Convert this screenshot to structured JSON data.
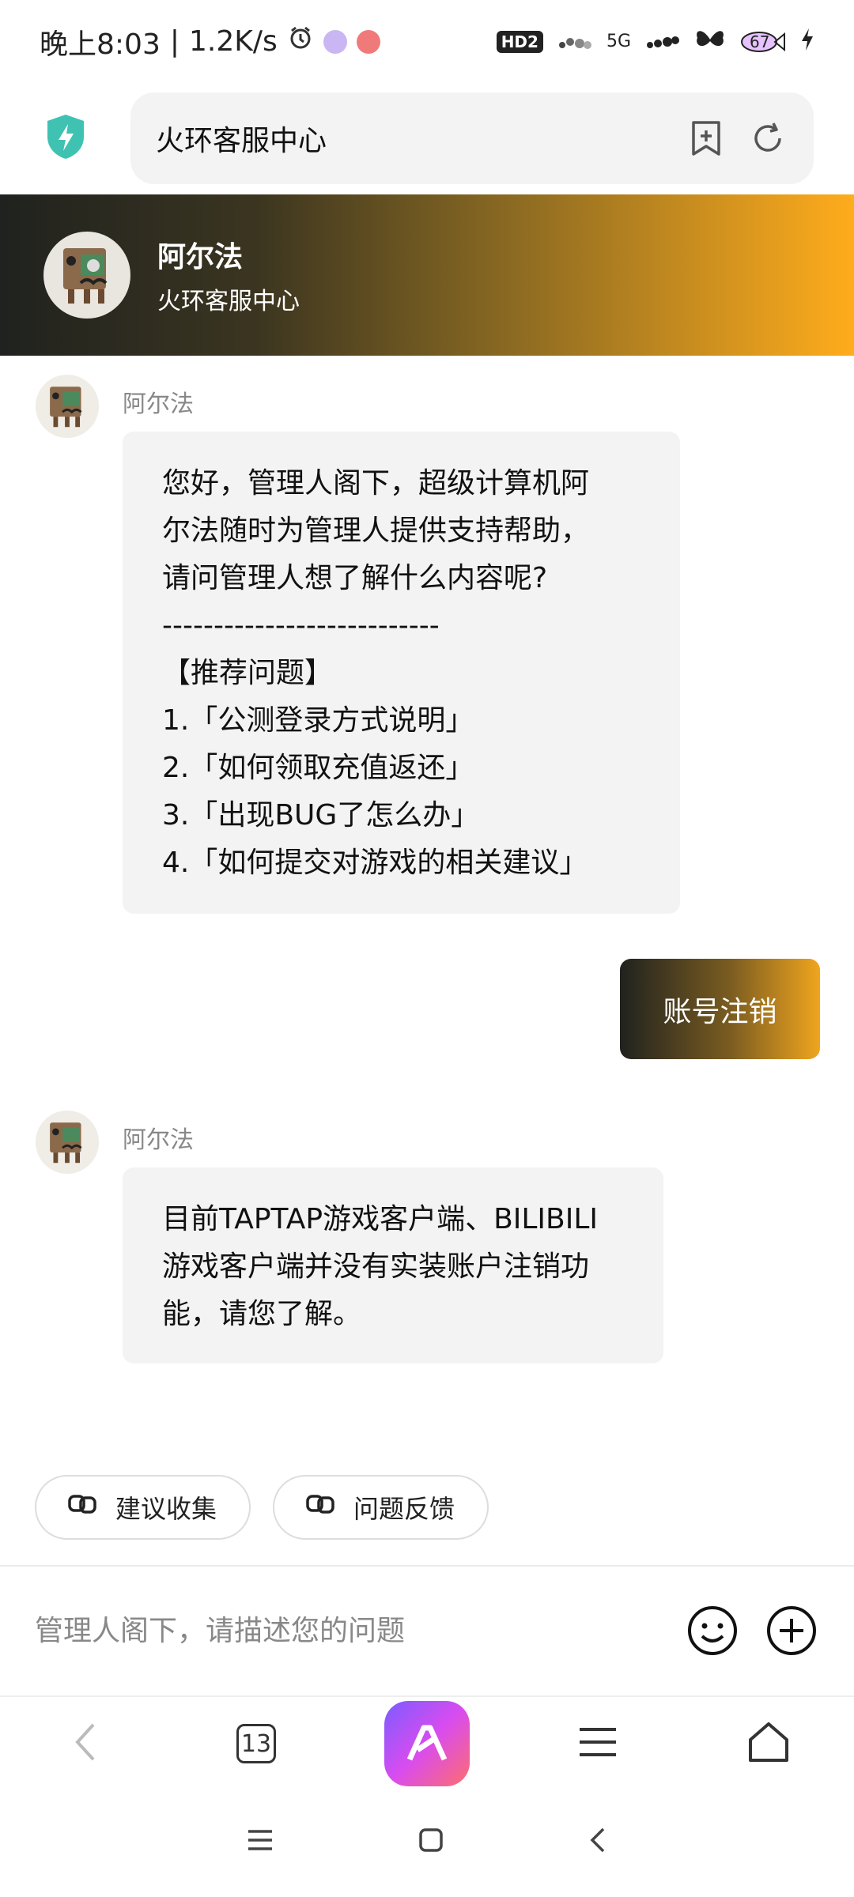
{
  "status_bar": {
    "time": "晚上8:03",
    "speed": "1.2K/s",
    "hd_badge": "HD2",
    "network": "5G",
    "battery": "67"
  },
  "address_bar": {
    "title": "火环客服中心",
    "icons": [
      "shield-bolt-icon",
      "add-bookmark-icon",
      "reload-icon"
    ]
  },
  "header": {
    "bot_name": "阿尔法",
    "subtitle": "火环客服中心"
  },
  "messages": [
    {
      "sender": "阿尔法",
      "lines": [
        "您好，管理人阁下，超级计算机阿",
        "尔法随时为管理人提供支持帮助，",
        "请问管理人想了解什么内容呢?",
        "---------------------------",
        "【推荐问题】",
        "1.「公测登录方式说明」",
        "2.「如何领取充值返还」",
        "3.「出现BUG了怎么办」",
        "4.「如何提交对游戏的相关建议」"
      ]
    },
    {
      "sender": "user",
      "text": "账号注销"
    },
    {
      "sender": "阿尔法",
      "lines": [
        "目前TAPTAP游戏客户端、BILIBILI",
        "游戏客户端并没有实装账户注销功",
        "能，请您了解。"
      ]
    }
  ],
  "quick_actions": [
    {
      "label": "建议收集",
      "icon": "link-icon"
    },
    {
      "label": "问题反馈",
      "icon": "link-icon"
    }
  ],
  "input": {
    "placeholder": "管理人阁下，请描述您的问题",
    "value": ""
  },
  "browser_bar": {
    "tab_count": "13"
  },
  "colors": {
    "accent": "#ffac1c",
    "dark": "#20221f",
    "bubble_bg": "#f3f3f3"
  }
}
